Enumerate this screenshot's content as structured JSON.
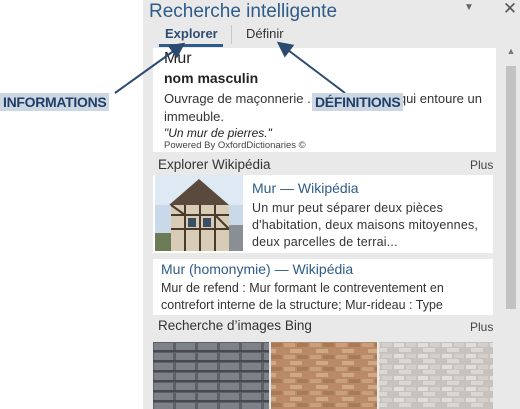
{
  "pane": {
    "title": "Recherche intelligente",
    "menu_icon": "chevron-down-icon",
    "close_icon": "close-icon",
    "close_glyph": "✕",
    "menu_glyph": "▼"
  },
  "tabs": [
    {
      "label": "Explorer",
      "active": true
    },
    {
      "label": "Définir",
      "active": false
    }
  ],
  "definition": {
    "word": "Mur",
    "pos": "nom masculin",
    "text": "Ouvrage de maçonnerie ... construction, qui entoure un immeuble.",
    "example": "\"Un mur de pierres.\"",
    "powered_by": "Powered By OxfordDictionaries ©"
  },
  "wikipedia": {
    "heading": "Explorer Wikipédia",
    "more": "Plus",
    "main": {
      "title": "Mur — Wikipédia",
      "snippet": "Un mur peut séparer deux pièces d'habitation, deux maisons mitoyennes, deux parcelles de terrai..."
    },
    "secondary": {
      "title": "Mur (homonymie) — Wikipédia",
      "snippet": "Mur de refend : Mur formant le contreventement en contrefort interne de la structure; Mur-rideau : Type"
    }
  },
  "bing": {
    "heading": "Recherche d’images Bing",
    "more": "Plus"
  },
  "annotations": {
    "informations": "INFORMATIONS",
    "definitions": "DÉFINITIONS"
  },
  "colors": {
    "accent": "#2e5c8a",
    "pane_bg": "#e9e9e9",
    "callout_bg": "#cdd7e4"
  }
}
